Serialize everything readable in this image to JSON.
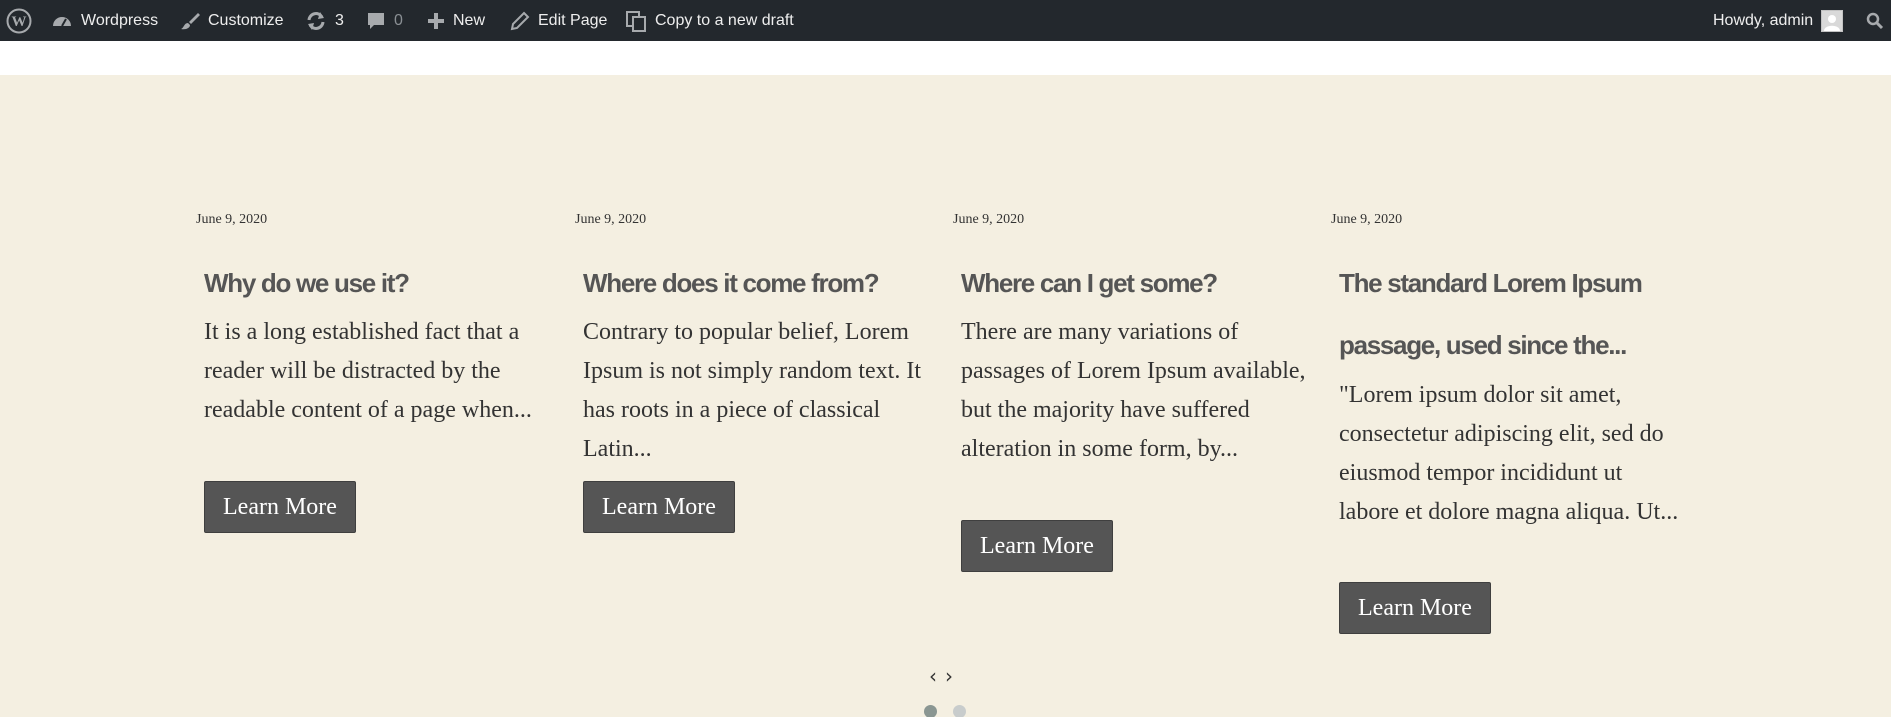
{
  "admin_bar": {
    "site_name": "Wordpress",
    "customize": "Customize",
    "updates_count": "3",
    "comments_count": "0",
    "new": "New",
    "edit_page": "Edit Page",
    "copy_draft": "Copy to a new draft",
    "howdy": "Howdy, admin"
  },
  "posts": [
    {
      "date": "June 9, 2020",
      "title": "Why do we use it?",
      "excerpt": "It is a long established fact that a reader will be distracted by the readable content of a page when...",
      "button": "Learn More"
    },
    {
      "date": "June 9, 2020",
      "title": "Where does it come from?",
      "excerpt": "Contrary to popular belief, Lorem Ipsum is not simply random text. It has roots in a piece of classical Latin...",
      "button": "Learn More"
    },
    {
      "date": "June 9, 2020",
      "title": "Where can I get some?",
      "excerpt": "There are many variations of passages of Lorem Ipsum available, but the majority have suffered alteration in some form, by...",
      "button": "Learn More"
    },
    {
      "date": "June 9, 2020",
      "title": "The standard Lorem Ipsum passage, used since the...",
      "excerpt": "\"Lorem ipsum dolor sit amet, consectetur adipiscing elit, sed do eiusmod tempor incididunt ut labore et dolore magna aliqua. Ut...",
      "button": "Learn More"
    }
  ],
  "slider": {
    "prev": "‹",
    "next": "›"
  },
  "colors": {
    "admin_bar_bg": "#23282d",
    "section_bg": "#f4efe1",
    "button_bg": "#555555"
  }
}
